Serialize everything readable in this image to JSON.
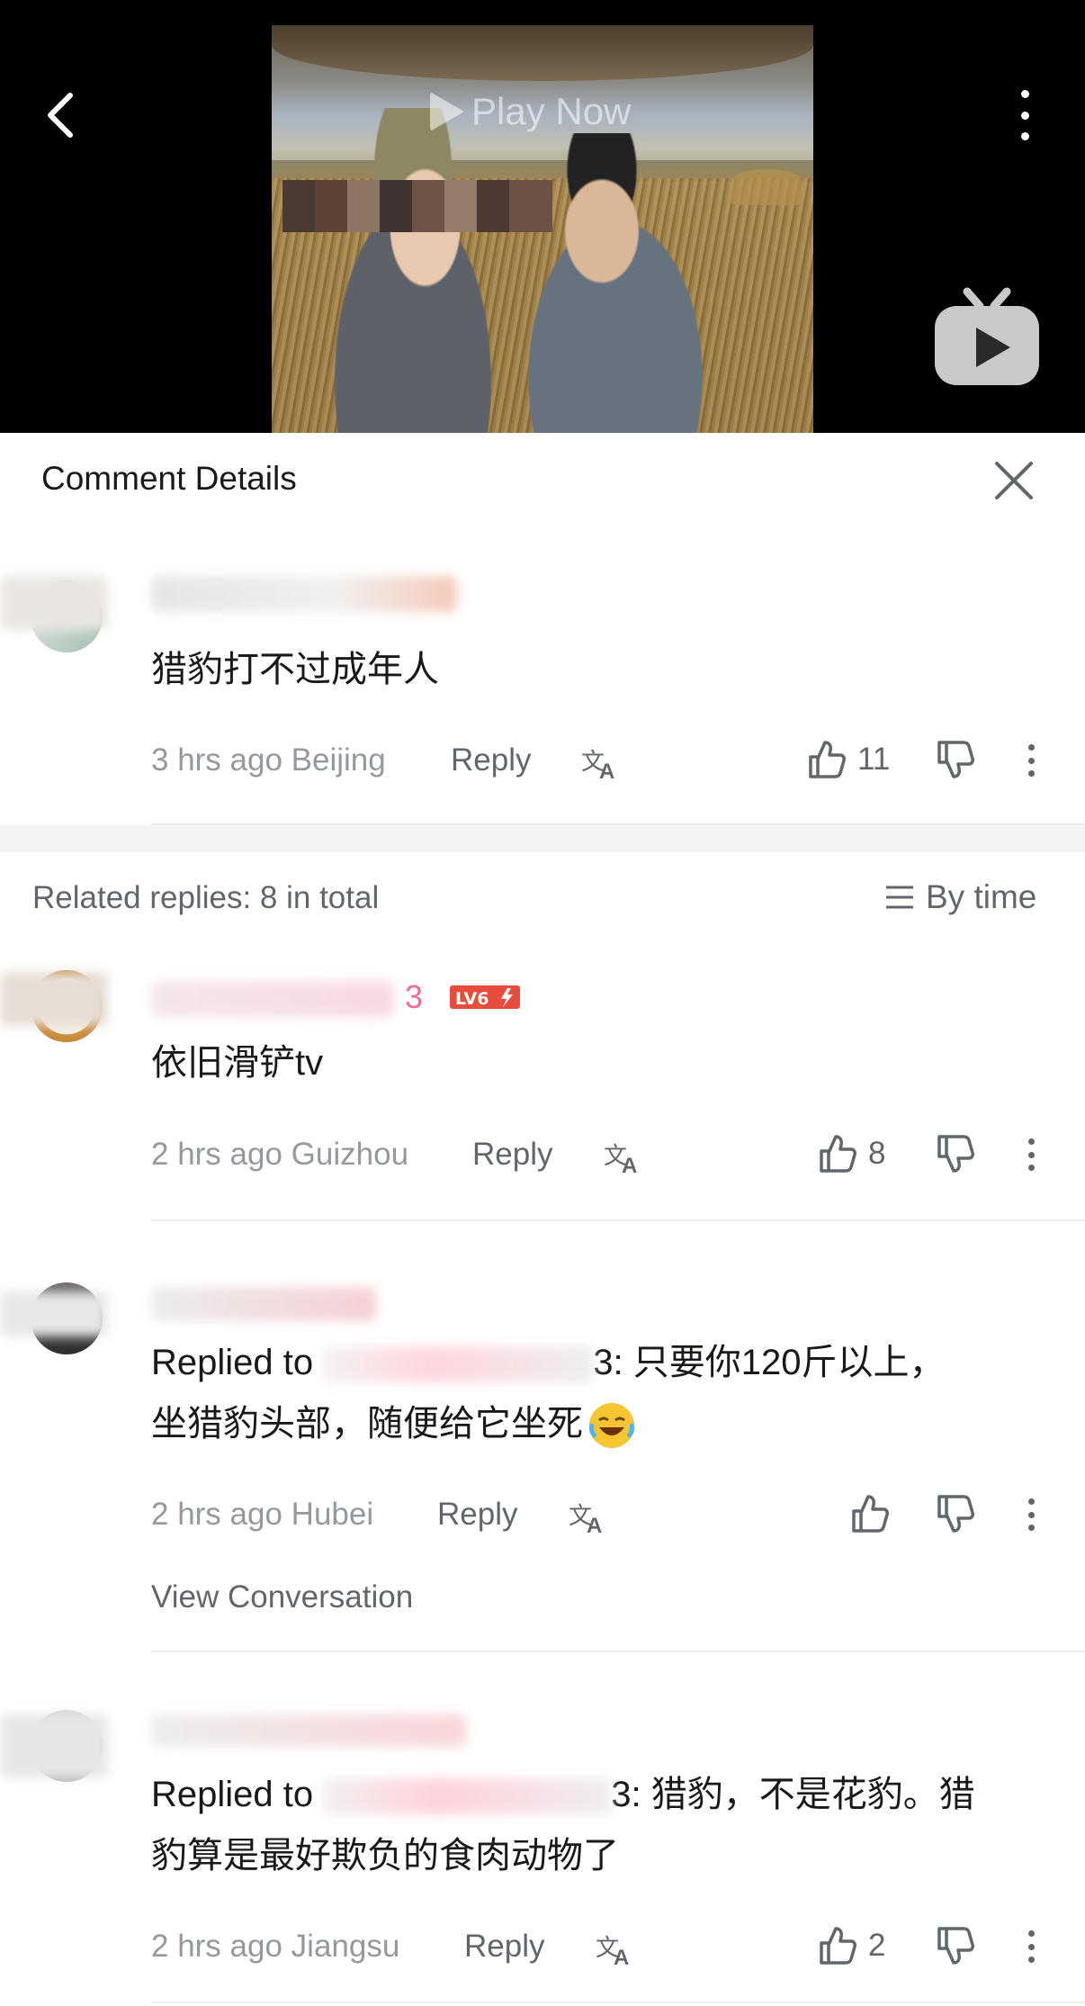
{
  "video": {
    "play_label": "Play Now",
    "icons": {
      "back": "chevron-left-icon",
      "more": "more-vertical-icon",
      "logo": "tv-logo-icon"
    }
  },
  "header": {
    "title": "Comment Details",
    "close_icon": "close-icon"
  },
  "main_comment": {
    "text": "猎豹打不过成年人",
    "time": "3 hrs ago",
    "location": "Beijing",
    "reply_label": "Reply",
    "likes": "11"
  },
  "related": {
    "label": "Related replies: 8 in total",
    "sort_label": "By time"
  },
  "replies": [
    {
      "username_tail": "3",
      "level": "LV6",
      "text": "依旧滑铲tv",
      "time": "2 hrs ago",
      "location": "Guizhou",
      "reply_label": "Reply",
      "likes": "8"
    },
    {
      "prefix": "Replied to",
      "line1_tail": "3: 只要你120斤以上，",
      "line2": "坐猎豹头部，随便给它坐死",
      "time": "2 hrs ago",
      "location": "Hubei",
      "reply_label": "Reply",
      "likes": "",
      "view_conversation": "View Conversation"
    },
    {
      "prefix": "Replied to",
      "line1_tail": "3: 猎豹，不是花豹。猎",
      "line2": "豹算是最好欺负的食肉动物了",
      "time": "2 hrs ago",
      "location": "Jiangsu",
      "reply_label": "Reply",
      "likes": "2"
    }
  ],
  "colors": {
    "meta_gray": "#9499a0",
    "text": "#18191c",
    "level_red": "#e74c3c",
    "pink": "#f06b9a"
  }
}
